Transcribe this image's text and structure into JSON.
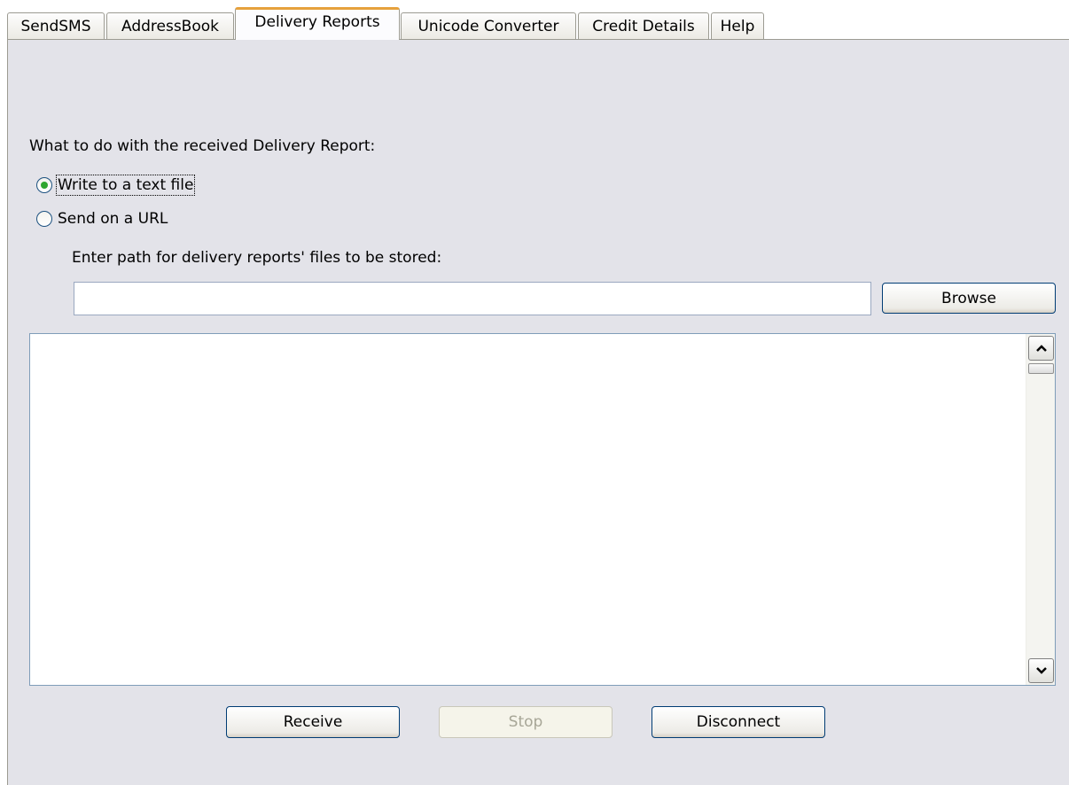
{
  "tabs": [
    {
      "label": "SendSMS",
      "active": false
    },
    {
      "label": "AddressBook",
      "active": false
    },
    {
      "label": "Delivery Reports",
      "active": true
    },
    {
      "label": "Unicode Converter",
      "active": false
    },
    {
      "label": "Credit Details",
      "active": false
    },
    {
      "label": "Help",
      "active": false
    }
  ],
  "delivery": {
    "question": "What to do with the received Delivery Report:",
    "options": [
      {
        "label": "Write to a text file",
        "selected": true
      },
      {
        "label": "Send on a URL",
        "selected": false
      }
    ],
    "path_label": "Enter path for delivery reports' files to be stored:",
    "path_value": "",
    "browse_label": "Browse",
    "log_text": ""
  },
  "buttons": {
    "receive": "Receive",
    "stop": "Stop",
    "stop_enabled": false,
    "disconnect": "Disconnect"
  },
  "icons": {
    "scroll_up": "chevron-up-icon",
    "scroll_down": "chevron-down-icon"
  },
  "colors": {
    "panel_bg": "#e3e3e9",
    "active_tab_accent": "#e6a13c",
    "radio_dot": "#2fa62f",
    "button_border": "#003c74"
  }
}
